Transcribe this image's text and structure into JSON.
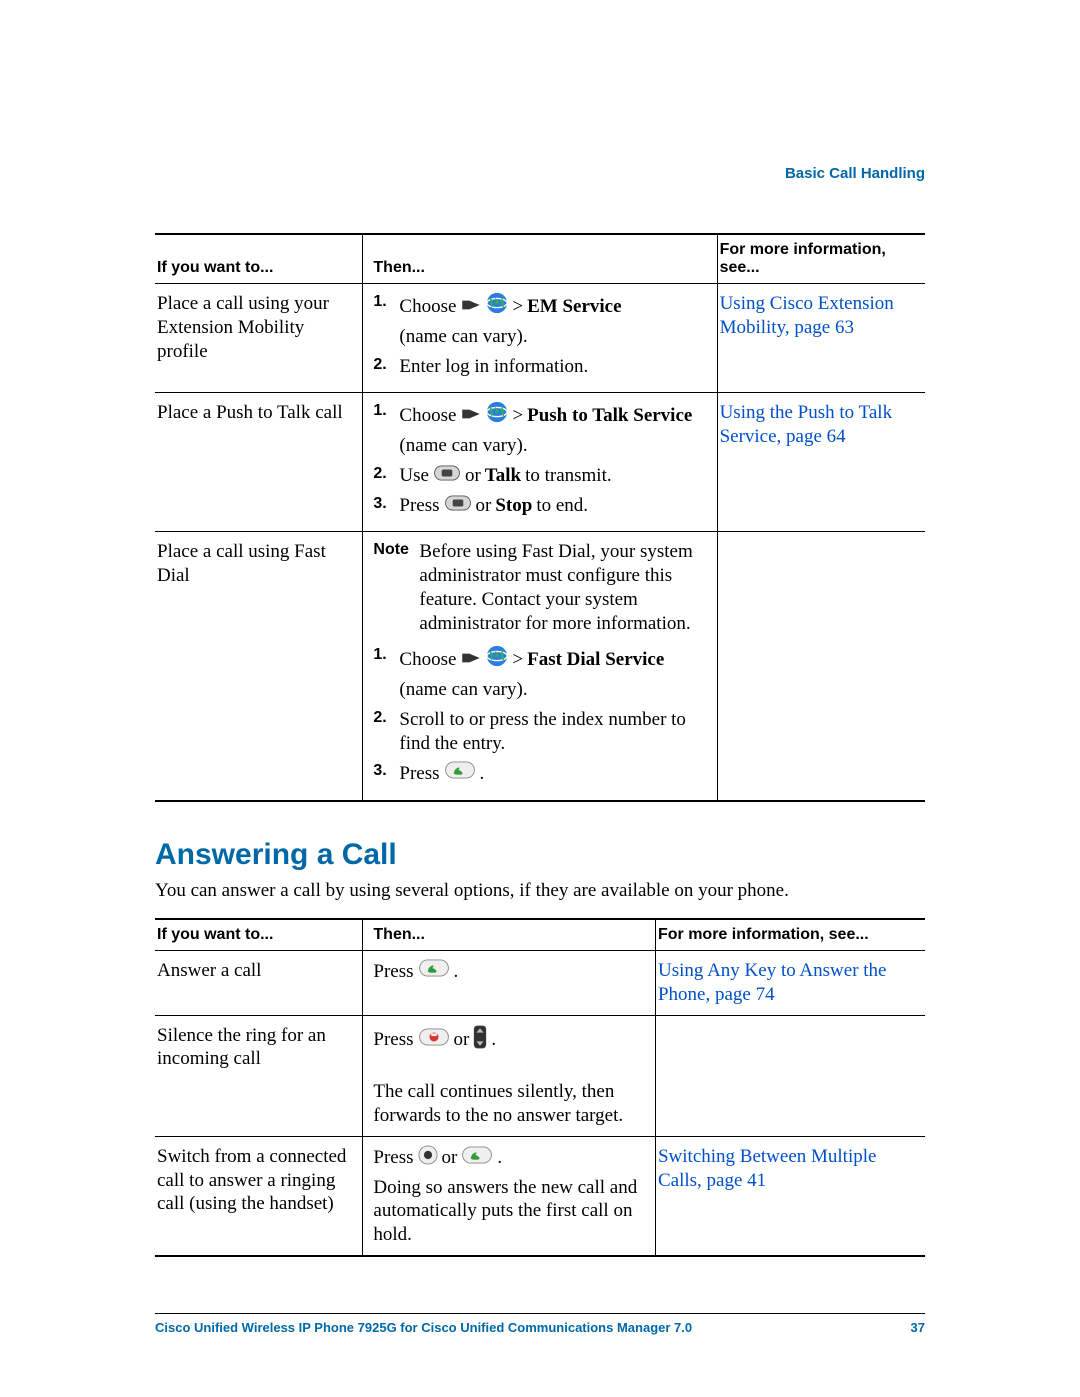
{
  "header": {
    "section": "Basic Call Handling"
  },
  "t1": {
    "head": {
      "c1": "If you want to...",
      "c2": "Then...",
      "c3": "For more information, see..."
    },
    "rows": [
      {
        "c1": "Place a call using your Extension Mobility profile",
        "steps": [
          {
            "n": "1.",
            "pre": "Choose ",
            "icons": [
              "speaker",
              "globe"
            ],
            "post1": " > ",
            "bold": "EM Service",
            "post2": " (name can vary)."
          },
          {
            "n": "2.",
            "text": "Enter log in information."
          }
        ],
        "c3": "Using Cisco Extension Mobility, page 63"
      },
      {
        "c1": "Place a Push to Talk call",
        "steps": [
          {
            "n": "1.",
            "pre": "Choose ",
            "icons": [
              "speaker",
              "globe"
            ],
            "post1": " > ",
            "bold": "Push to Talk Service",
            "post2": " (name can vary)."
          },
          {
            "n": "2.",
            "pre": "Use ",
            "icons": [
              "sidebutton"
            ],
            "post1": " or ",
            "bold": "Talk",
            "post2": " to transmit."
          },
          {
            "n": "3.",
            "pre": "Press ",
            "icons": [
              "sidebutton"
            ],
            "post1": " or ",
            "bold": "Stop",
            "post2": " to end."
          }
        ],
        "c3": "Using the Push to Talk Service, page 64"
      },
      {
        "c1": "Place a call using Fast Dial",
        "note": "Before using Fast Dial, your system administrator must configure this feature. Contact your system administrator for more information.",
        "note_lbl": "Note",
        "steps": [
          {
            "n": "1.",
            "pre": "Choose ",
            "icons": [
              "speaker",
              "globe"
            ],
            "post1": " > ",
            "bold": "Fast Dial Service",
            "post2": " (name can vary)."
          },
          {
            "n": "2.",
            "text": "Scroll to or press the index number to find the entry."
          },
          {
            "n": "3.",
            "pre": "Press ",
            "icons": [
              "callgreen"
            ],
            "post2": " ."
          }
        ],
        "c3": ""
      }
    ]
  },
  "section_title": "Answering a Call",
  "section_intro": "You can answer a call by using several options, if they are available on your phone.",
  "t2": {
    "head": {
      "c1": "If you want to...",
      "c2": "Then...",
      "c3": "For more information, see..."
    },
    "rows": [
      {
        "c1": "Answer a call",
        "pre": "Press ",
        "icons": [
          "callgreen"
        ],
        "post2": " .",
        "c3": "Using Any Key to Answer the Phone, page 74"
      },
      {
        "c1": "Silence the ring for an incoming call",
        "pre": "Press ",
        "icons": [
          "endred"
        ],
        "mid": " or ",
        "icons2": [
          "voldown"
        ],
        "post2": " .",
        "tail": "The call continues silently, then forwards to the no answer target.",
        "c3": ""
      },
      {
        "c1": "Switch from a connected call to answer a ringing call (using the handset)",
        "pre": "Press ",
        "icons": [
          "select"
        ],
        "mid": " or ",
        "icons2": [
          "callgreen"
        ],
        "post2": " .",
        "tail": "Doing so answers the new call and automatically puts the first call on hold.",
        "c3": "Switching Between Multiple Calls, page 41"
      }
    ]
  },
  "footer": {
    "title": "Cisco Unified Wireless IP Phone 7925G for Cisco Unified Communications Manager 7.0",
    "page": "37"
  }
}
